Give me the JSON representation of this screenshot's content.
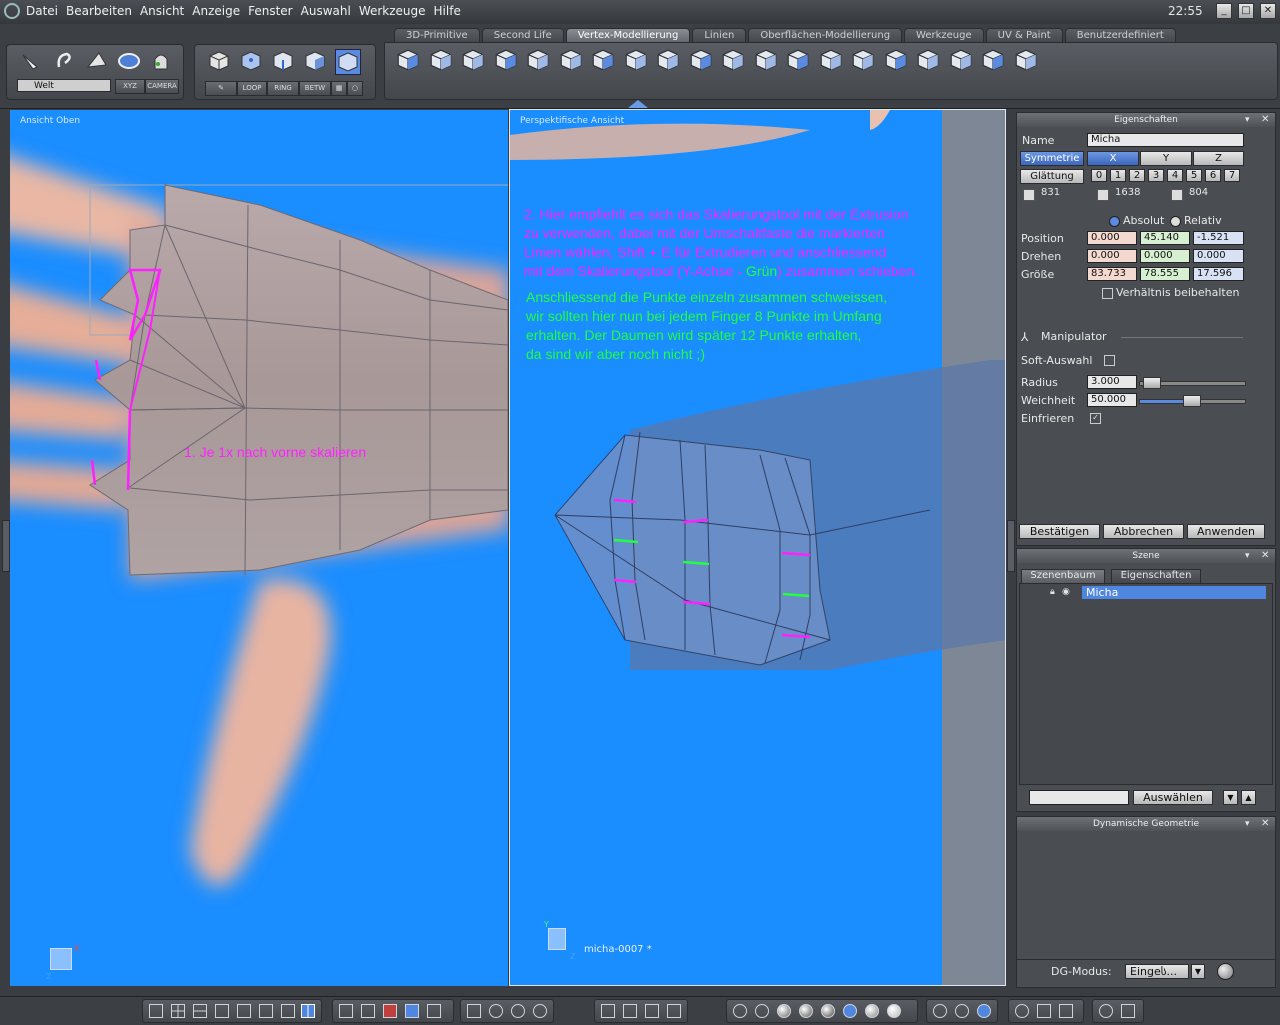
{
  "menubar": {
    "items": [
      "Datei",
      "Bearbeiten",
      "Ansicht",
      "Anzeige",
      "Fenster",
      "Auswahl",
      "Werkzeuge",
      "Hilfe"
    ],
    "clock": "22:55"
  },
  "toolbar": {
    "coord_select": "Welt",
    "xyz_label": "XYZ",
    "camera_label": "CAMERA",
    "loop_label": "LOOP",
    "ring_label": "RING",
    "betw_label": "BETW",
    "tabs": [
      "3D-Primitive",
      "Second Life",
      "Vertex-Modellierung",
      "Linien",
      "Oberflächen-Modellierung",
      "Werkzeuge",
      "UV & Paint",
      "Benutzerdefiniert"
    ],
    "active_tab": "Vertex-Modellierung"
  },
  "viewport_top": {
    "title": "Ansicht Oben",
    "annotation": "1. Je 1x nach vorne skalieren",
    "axis_x": "X",
    "axis_z": "Z"
  },
  "viewport_persp": {
    "title": "Perspektifische Ansicht",
    "annotation_magenta_1": "2. Hier empfiehlt es sich das Skalierungstool mit der Extrusion",
    "annotation_magenta_2": "zu verwenden, dabei mit der Umschaltfaste die markierten",
    "annotation_magenta_3": "Linien wählen, Shift + E für Extrudieren und anschliessend",
    "annotation_magenta_4a": "mit dem Skalierungstool (Y-Achse - ",
    "annotation_magenta_4g": "Grün",
    "annotation_magenta_4b": ") zusammen schieben.",
    "annotation_green_1": "Anschliessend die Punkte einzeln zusammen schweissen,",
    "annotation_green_2": "wir sollten hier nun bei jedem Finger 8 Punkte im Umfang",
    "annotation_green_3": "erhalten. Der Daumen wird später 12 Punkte erhalten,",
    "annotation_green_4": "da sind wir aber noch nicht ;)",
    "object_label": "micha-0007 *",
    "axis_y": "Y",
    "axis_z": "Z"
  },
  "properties": {
    "title": "Eigenschaften",
    "name_label": "Name",
    "name_value": "Micha",
    "symmetrie": "Symmetrie",
    "sym_x": "X",
    "sym_y": "Y",
    "sym_z": "Z",
    "glaettung": "Glättung",
    "levels": [
      "0",
      "1",
      "2",
      "3",
      "4",
      "5",
      "6",
      "7"
    ],
    "count1": "831",
    "count2": "1638",
    "count3": "804",
    "absolut": "Absolut",
    "relativ": "Relativ",
    "position_label": "Position",
    "position": [
      "0.000",
      "45.140",
      "-1.521"
    ],
    "drehen_label": "Drehen",
    "drehen": [
      "0.000",
      "0.000",
      "0.000"
    ],
    "groesse_label": "Größe",
    "groesse": [
      "83.733",
      "78.555",
      "17.596"
    ],
    "verhaeltnis": "Verhältnis beibehalten",
    "manipulator": "Manipulator",
    "soft_auswahl": "Soft-Auswahl",
    "radius_label": "Radius",
    "radius": "3.000",
    "weichheit_label": "Weichheit",
    "weichheit": "50.000",
    "einfrieren": "Einfrieren",
    "btn_ok": "Bestätigen",
    "btn_cancel": "Abbrechen",
    "btn_apply": "Anwenden"
  },
  "scene": {
    "title": "Szene",
    "tab1": "Szenenbaum",
    "tab2": "Eigenschaften",
    "item": "Micha",
    "select_btn": "Auswählen"
  },
  "dyngeo": {
    "title": "Dynamische Geometrie",
    "mode_label": "DG-Modus:",
    "mode_value": "Eingeს..."
  }
}
